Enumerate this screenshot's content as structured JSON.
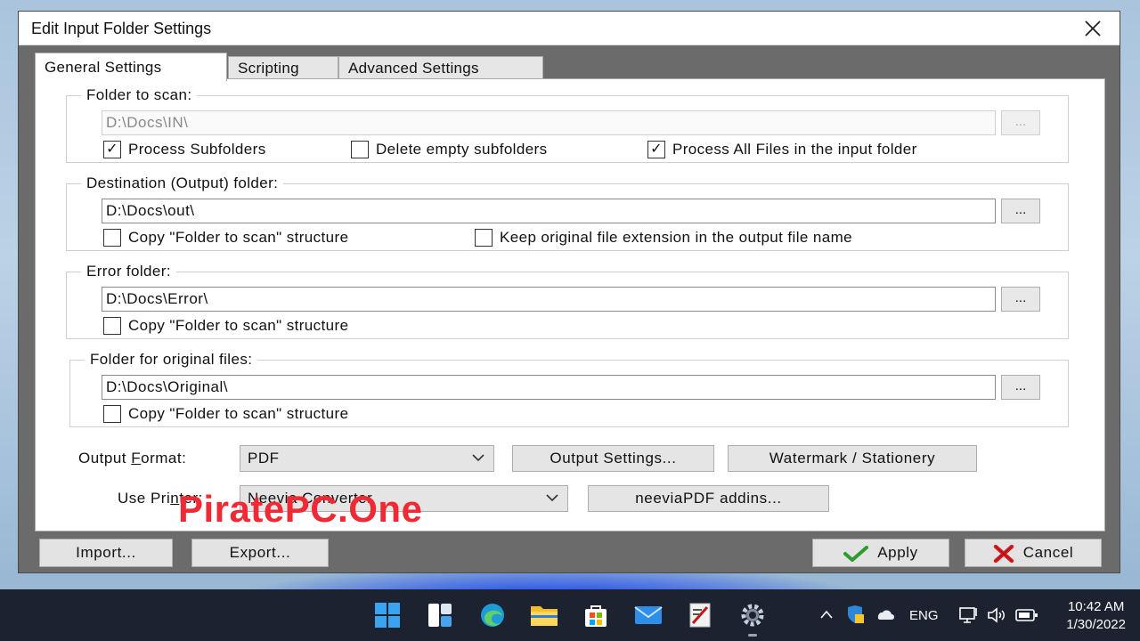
{
  "window": {
    "title": "Edit Input Folder Settings"
  },
  "tabs": [
    "General Settings",
    "Scripting",
    "Advanced Settings"
  ],
  "folder_to_scan": {
    "legend": "Folder to scan:",
    "path": "D:\\Docs\\IN\\",
    "browse_label": "...",
    "checkboxes": [
      {
        "label": "Process Subfolders",
        "checked": true
      },
      {
        "label": "Delete empty subfolders",
        "checked": false
      },
      {
        "label": "Process All Files in the input folder",
        "checked": true
      }
    ]
  },
  "destination_folder": {
    "legend": "Destination (Output) folder:",
    "path": "D:\\Docs\\out\\",
    "browse_label": "...",
    "checkboxes": [
      {
        "label": "Copy \"Folder to scan\" structure",
        "checked": false
      },
      {
        "label": "Keep original file extension in the output file name",
        "checked": false
      }
    ]
  },
  "error_folder": {
    "legend": "Error folder:",
    "path": "D:\\Docs\\Error\\",
    "browse_label": "...",
    "checkboxes": [
      {
        "label": "Copy \"Folder to scan\" structure",
        "checked": false
      }
    ]
  },
  "original_folder": {
    "legend": "Folder for original files:",
    "path": "D:\\Docs\\Original\\",
    "browse_label": "...",
    "checkboxes": [
      {
        "label": "Copy \"Folder to scan\" structure",
        "checked": false
      }
    ]
  },
  "output_format": {
    "label_pre": "Output ",
    "label_accel": "F",
    "label_post": "ormat:",
    "value": "PDF",
    "output_settings_button": "Output Settings...",
    "watermark_button": "Watermark / Stationery"
  },
  "use_printer": {
    "label_pre": "Use Pri",
    "label_accel": "n",
    "label_post": "ter:",
    "value": "Neevia Converter",
    "addins_button": "neeviaPDF addins..."
  },
  "footer": {
    "import_button": "Import...",
    "export_button": "Export...",
    "apply_button": "Apply",
    "cancel_button": "Cancel"
  },
  "overlay_watermark": "PiratePC.One",
  "taskbar": {
    "language": "ENG",
    "time": "10:42 AM",
    "date": "1/30/2022",
    "icons": [
      "windows-start-icon",
      "widgets-icon",
      "edge-icon",
      "file-explorer-icon",
      "store-icon",
      "mail-icon",
      "neevia-app-icon",
      "settings-gear-icon"
    ]
  }
}
